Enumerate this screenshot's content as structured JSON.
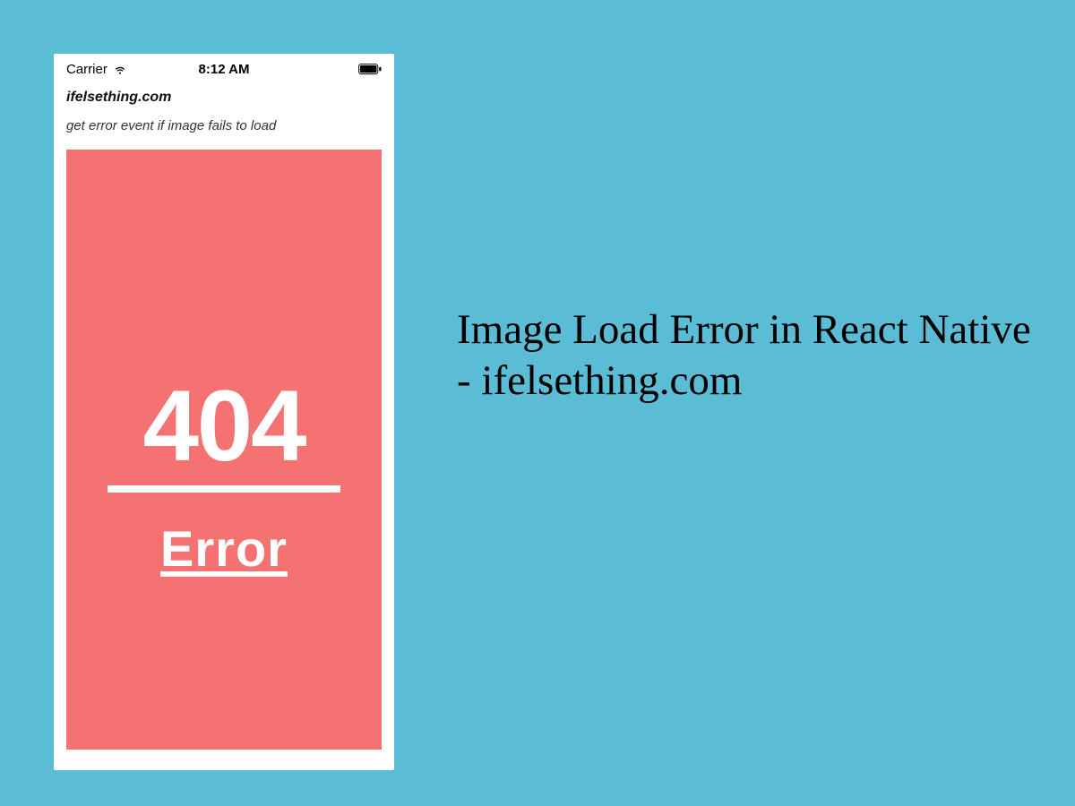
{
  "status_bar": {
    "carrier": "Carrier",
    "time": "8:12 AM"
  },
  "app": {
    "title": "ifelsething.com",
    "subtitle": "get error event if image fails to load"
  },
  "error_image": {
    "code": "404",
    "label": "Error"
  },
  "headline": "Image Load Error in React Native - ifelsething.com",
  "colors": {
    "background": "#5bbdd5",
    "error_panel": "#f47272",
    "white": "#ffffff"
  }
}
